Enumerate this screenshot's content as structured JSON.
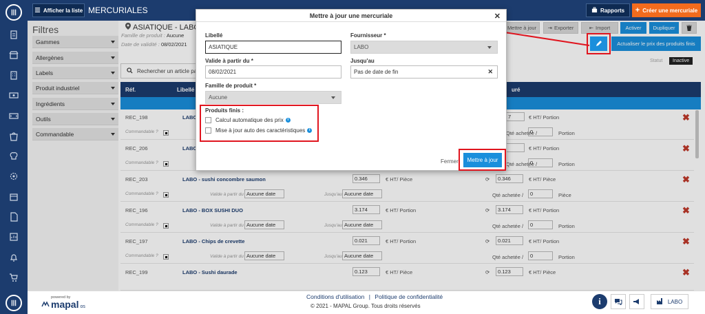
{
  "topbar": {
    "list_button": "Afficher la liste",
    "title": "MERCURIALES",
    "reports_button": "Rapports",
    "create_button": "Créer une mercuriale"
  },
  "filters": {
    "title": "Filtres",
    "items": [
      "Gammes",
      "Allergènes",
      "Labels",
      "Produit industriel",
      "Ingrédients",
      "Outils",
      "Commandable"
    ]
  },
  "main": {
    "title": "ASIATIQUE - LABO",
    "family_label": "Famille de produit :",
    "family_value": "Aucune",
    "date_label": "Date de validité :",
    "date_value": "08/02/2021",
    "toolbar": {
      "update": "Mettre à jour",
      "export": "Exporter",
      "import": "Import",
      "activate": "Activer",
      "duplicate": "Dupliquer",
      "refresh_prices": "Actualiser le prix des produits finis"
    },
    "status_label": "Statut",
    "status_value": "Inactive",
    "search_placeholder": "Rechercher un article par",
    "columns": {
      "ref": "Réf.",
      "label": "Libellé",
      "price": "uré"
    }
  },
  "rows": [
    {
      "ref": "REC_198",
      "label": "LABO",
      "price_new": "7",
      "unit": "€ HT/ Portion",
      "qty": "0",
      "qty_unit": "Portion",
      "partial": true
    },
    {
      "ref": "REC_206",
      "label": "LABO",
      "price_new": "",
      "unit": "€ HT/ Portion",
      "qty": "0",
      "qty_unit": "Portion",
      "partial": true
    },
    {
      "ref": "REC_203",
      "label": "LABO - sushi concombre saumon",
      "price": "0.346",
      "price_unit": "€ HT/ Pièce",
      "price_new": "0.346",
      "unit": "€ HT/ Pièce",
      "qty": "0",
      "qty_unit": "Pièce"
    },
    {
      "ref": "REC_196",
      "label": "LABO - BOX SUSHI DUO",
      "price": "3.174",
      "price_unit": "€ HT/ Portion",
      "price_new": "3.174",
      "unit": "€ HT/ Portion",
      "qty": "0",
      "qty_unit": "Portion"
    },
    {
      "ref": "REC_197",
      "label": "LABO - Chips de crevette",
      "price": "0.021",
      "price_unit": "€ HT/ Portion",
      "price_new": "0.021",
      "unit": "€ HT/ Portion",
      "qty": "0",
      "qty_unit": "Portion"
    },
    {
      "ref": "REC_199",
      "label": "LABO - Sushi daurade",
      "price": "0.123",
      "price_unit": "€ HT/ Pièce",
      "price_new": "0.123",
      "unit": "€ HT/ Pièce",
      "qty": "",
      "qty_unit": ""
    }
  ],
  "row_common": {
    "orderable": "Commandable ?",
    "valid_from": "Valide à partir du",
    "until": "Jusqu'au",
    "no_date": "Aucune date",
    "qty_bought": "Qté achetée /"
  },
  "modal": {
    "title": "Mettre à jour une mercuriale",
    "label_label": "Libellé",
    "label_value": "ASIATIQUE",
    "supplier_label": "Fournisseur *",
    "supplier_value": "LABO",
    "valid_from_label": "Valide à partir du *",
    "valid_from_value": "08/02/2021",
    "until_label": "Jusqu'au",
    "until_value": "Pas de date de fin",
    "family_label": "Famille de produit *",
    "family_value": "Aucune",
    "finished_products_label": "Produits finis :",
    "auto_price": "Calcul automatique des prix",
    "auto_features": "Mise à jour auto des caractéristiques",
    "close_button": "Fermer",
    "save_button": "Mettre à jour"
  },
  "footer": {
    "powered_by": "powered by",
    "brand": "mapal",
    "brand_suffix": "os",
    "terms": "Conditions d'utilisation",
    "privacy": "Politique de confidentialité",
    "separator": "|",
    "copyright": "© 2021 - MAPAL Group. Tous droits réservés",
    "store": "LABO"
  },
  "colors": {
    "navy": "#1c3c6e",
    "blue": "#1a8fdc",
    "orange": "#f26b1d",
    "red": "#e0141e"
  }
}
